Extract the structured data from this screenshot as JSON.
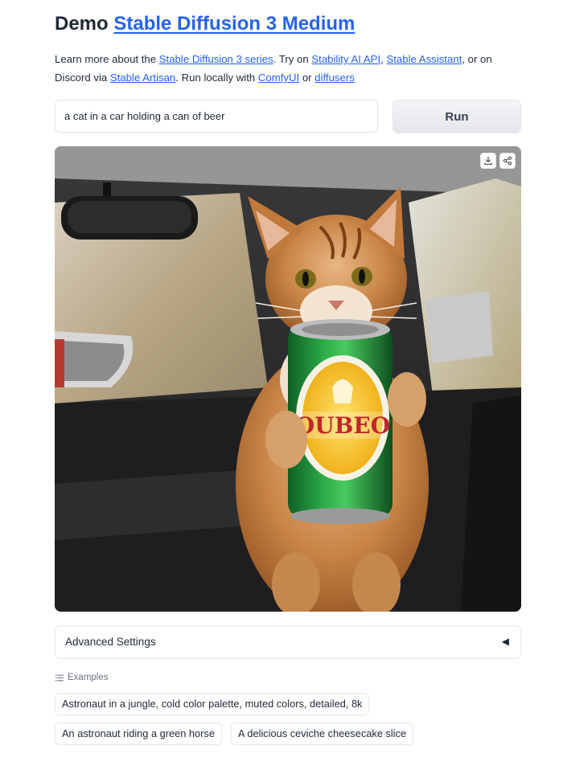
{
  "header": {
    "title_prefix": "Demo",
    "title_link": "Stable Diffusion 3 Medium"
  },
  "description": {
    "t1": "Learn more about the ",
    "link_series": "Stable Diffusion 3 series",
    "t2": ". Try on ",
    "link_api": "Stability AI API",
    "t3": ", ",
    "link_assistant": "Stable Assistant",
    "t4": ", or on Discord via ",
    "link_artisan": "Stable Artisan",
    "t5": ". Run locally with ",
    "link_comfy": "ComfyUI",
    "t6": " or ",
    "link_diffusers": "diffusers"
  },
  "prompt": {
    "value": "a cat in a car holding a can of beer"
  },
  "run_button": {
    "label": "Run"
  },
  "output_image": {
    "can_label": "OUBEO",
    "download_icon": "download-icon",
    "share_icon": "share-icon"
  },
  "advanced": {
    "label": "Advanced Settings",
    "arrow": "◀"
  },
  "examples": {
    "heading": "Examples",
    "items": [
      "Astronaut in a jungle, cold color palette, muted colors, detailed, 8k",
      "An astronaut riding a green horse",
      "A delicious ceviche cheesecake slice"
    ]
  },
  "colors": {
    "link": "#2563eb",
    "text": "#1f2937",
    "border": "#e5e7eb",
    "button_bg": "#e5e7eb"
  }
}
